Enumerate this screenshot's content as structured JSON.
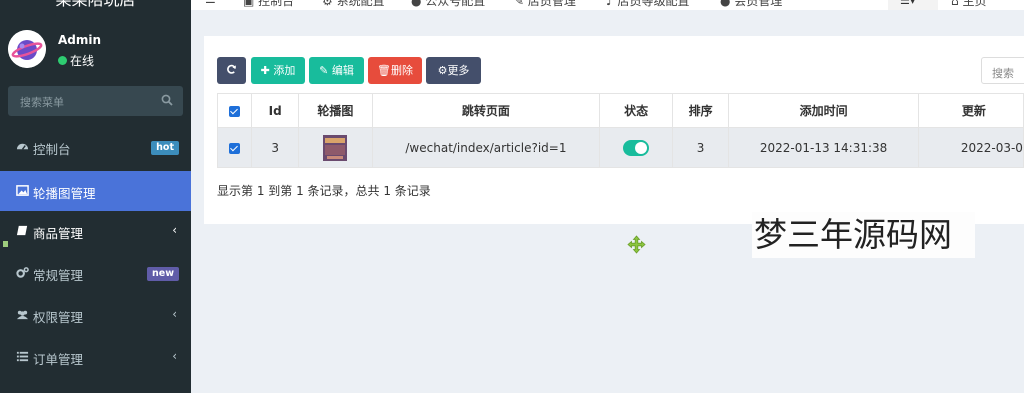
{
  "sidebar": {
    "brand": "某某陪玩店",
    "user": {
      "name": "Admin",
      "status": "在线"
    },
    "search_placeholder": "搜索菜单",
    "items": [
      {
        "label": "控制台",
        "icon": "dashboard-icon",
        "badge": "hot",
        "badge_color": "#3c8dbc"
      },
      {
        "label": "轮播图管理",
        "icon": "image-icon",
        "active": true
      },
      {
        "label": "商品管理",
        "icon": "book-icon",
        "arrow": "‹"
      },
      {
        "label": "常规管理",
        "icon": "cogs-icon",
        "badge": "new",
        "badge_color": "#605ca8"
      },
      {
        "label": "权限管理",
        "icon": "users-icon",
        "arrow": "‹"
      },
      {
        "label": "订单管理",
        "icon": "list-icon",
        "arrow": "‹"
      }
    ]
  },
  "topnav": {
    "tabs": [
      "控制台",
      "系统配置",
      "公众号配置",
      "店员管理",
      "店员等级配置",
      "会员管理"
    ],
    "home_label": "主页"
  },
  "toolbar": {
    "add_label": "添加",
    "edit_label": "编辑",
    "delete_label": "删除",
    "more_label": "更多",
    "search_placeholder": "搜索"
  },
  "table": {
    "headers": [
      "Id",
      "轮播图",
      "跳转页面",
      "状态",
      "排序",
      "添加时间",
      "更新"
    ],
    "rows": [
      {
        "id": "3",
        "url": "/wechat/index/article?id=1",
        "status": true,
        "sort": "3",
        "created": "2022-01-13 14:31:38",
        "updated": "2022-03-0"
      }
    ]
  },
  "summary": "显示第 1 到第 1 条记录，总共 1 条记录",
  "watermark": "梦三年源码网",
  "colors": {
    "sidebar_bg": "#222d32",
    "active_menu": "#4a73d9",
    "btn_refresh": "#444f6b",
    "btn_add": "#18bc9c",
    "btn_edit": "#18bc9c",
    "btn_delete": "#e74c3c",
    "btn_more": "#444f6b"
  }
}
